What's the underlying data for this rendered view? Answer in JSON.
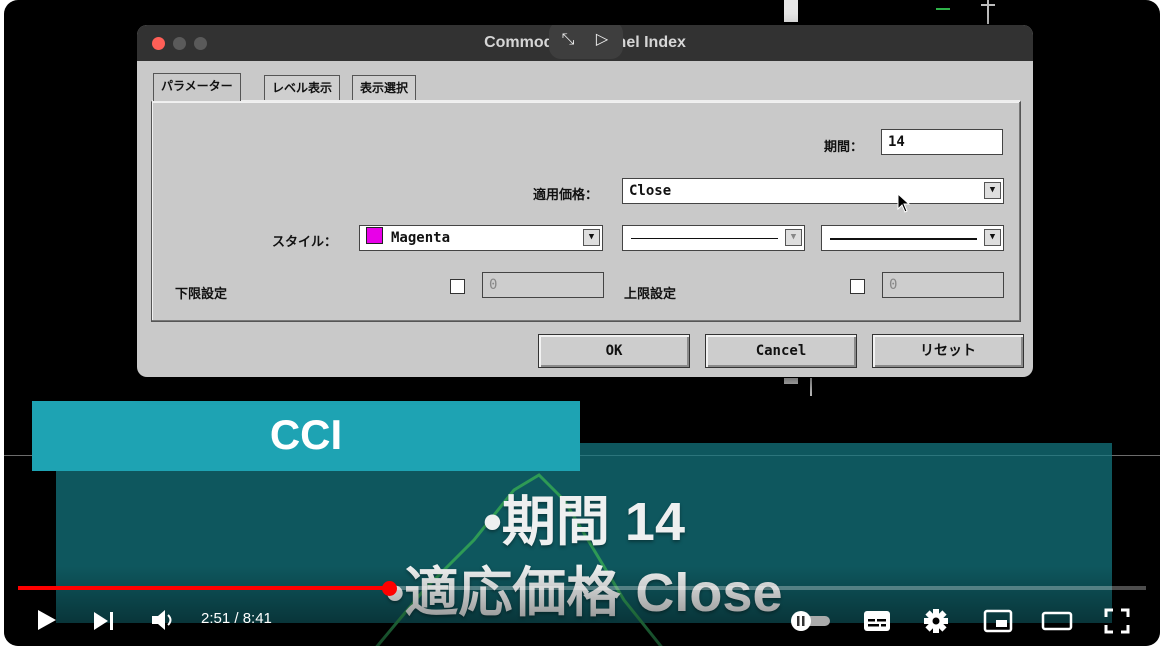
{
  "dialog": {
    "title": "Commodity Channel Index",
    "tabs": [
      "パラメーター",
      "レベル表示",
      "表示選択"
    ],
    "period_label": "期間：",
    "period_value": "14",
    "price_label": "適用価格：",
    "price_value": "Close",
    "style_label": "スタイル：",
    "style_color_name": "Magenta",
    "style_color": "#e800e8",
    "lower_label": "下限設定",
    "lower_value": "0",
    "upper_label": "上限設定",
    "upper_value": "0",
    "buttons": {
      "ok": "OK",
      "cancel": "Cancel",
      "reset": "リセット"
    }
  },
  "caption": {
    "tag": "CCI",
    "line1": "•期間 14",
    "line2": "•適応価格 Close"
  },
  "player": {
    "time": "2:51 / 8:41",
    "progress_fraction": 0.329,
    "progress_color": "#ff0000"
  },
  "colors": {
    "caption_tag": "#1ea3b3",
    "caption_box": "#147882",
    "titlebar": "#323232"
  }
}
